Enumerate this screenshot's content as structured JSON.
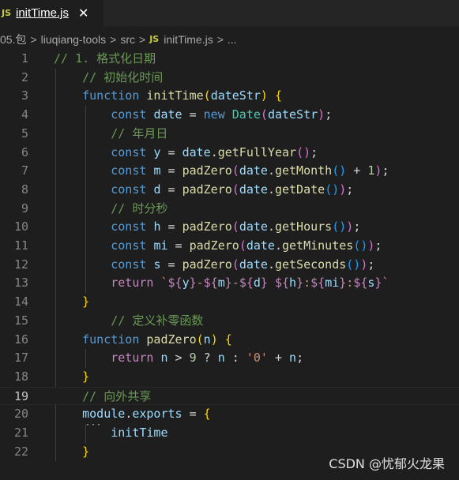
{
  "tab": {
    "icon_text": "JS",
    "label": "initTime.js",
    "close": "✕"
  },
  "breadcrumb": {
    "items": [
      "05.包",
      "liuqiang-tools",
      "src"
    ],
    "file_icon": "JS",
    "file": "initTime.js",
    "more": "..."
  },
  "watermark": "CSDN @忧郁火龙果",
  "code_lines": [
    {
      "n": "1",
      "tokens": [
        [
          "// 1. 格式化日期",
          "c"
        ]
      ]
    },
    {
      "n": "2",
      "tokens": [
        [
          "    // 初始化时间",
          "c"
        ]
      ]
    },
    {
      "n": "3",
      "tokens": [
        [
          "    ",
          "p"
        ],
        [
          "function",
          "k"
        ],
        [
          " ",
          "p"
        ],
        [
          "initTime",
          "f"
        ],
        [
          "(",
          "b1"
        ],
        [
          "dateStr",
          "v"
        ],
        [
          ")",
          "b1"
        ],
        [
          " ",
          "p"
        ],
        [
          "{",
          "b1"
        ]
      ]
    },
    {
      "n": "4",
      "tokens": [
        [
          "        ",
          "p"
        ],
        [
          "const",
          "k"
        ],
        [
          " ",
          "p"
        ],
        [
          "date",
          "v"
        ],
        [
          " = ",
          "p"
        ],
        [
          "new",
          "k"
        ],
        [
          " ",
          "p"
        ],
        [
          "Date",
          "t"
        ],
        [
          "(",
          "b2"
        ],
        [
          "dateStr",
          "v"
        ],
        [
          ")",
          "b2"
        ],
        [
          ";",
          "p"
        ]
      ]
    },
    {
      "n": "5",
      "tokens": [
        [
          "        // 年月日",
          "c"
        ]
      ]
    },
    {
      "n": "6",
      "tokens": [
        [
          "        ",
          "p"
        ],
        [
          "const",
          "k"
        ],
        [
          " ",
          "p"
        ],
        [
          "y",
          "v"
        ],
        [
          " = ",
          "p"
        ],
        [
          "date",
          "v"
        ],
        [
          ".",
          "p"
        ],
        [
          "getFullYear",
          "f"
        ],
        [
          "()",
          "b2"
        ],
        [
          ";",
          "p"
        ]
      ]
    },
    {
      "n": "7",
      "tokens": [
        [
          "        ",
          "p"
        ],
        [
          "const",
          "k"
        ],
        [
          " ",
          "p"
        ],
        [
          "m",
          "v"
        ],
        [
          " = ",
          "p"
        ],
        [
          "padZero",
          "f"
        ],
        [
          "(",
          "b2"
        ],
        [
          "date",
          "v"
        ],
        [
          ".",
          "p"
        ],
        [
          "getMonth",
          "f"
        ],
        [
          "()",
          "b3"
        ],
        [
          " + ",
          "p"
        ],
        [
          "1",
          "n"
        ],
        [
          ")",
          "b2"
        ],
        [
          ";",
          "p"
        ]
      ]
    },
    {
      "n": "8",
      "tokens": [
        [
          "        ",
          "p"
        ],
        [
          "const",
          "k"
        ],
        [
          " ",
          "p"
        ],
        [
          "d",
          "v"
        ],
        [
          " = ",
          "p"
        ],
        [
          "padZero",
          "f"
        ],
        [
          "(",
          "b2"
        ],
        [
          "date",
          "v"
        ],
        [
          ".",
          "p"
        ],
        [
          "getDate",
          "f"
        ],
        [
          "()",
          "b3"
        ],
        [
          ")",
          "b2"
        ],
        [
          ";",
          "p"
        ]
      ]
    },
    {
      "n": "9",
      "tokens": [
        [
          "        // 时分秒",
          "c"
        ]
      ]
    },
    {
      "n": "10",
      "tokens": [
        [
          "        ",
          "p"
        ],
        [
          "const",
          "k"
        ],
        [
          " ",
          "p"
        ],
        [
          "h",
          "v"
        ],
        [
          " = ",
          "p"
        ],
        [
          "padZero",
          "f"
        ],
        [
          "(",
          "b2"
        ],
        [
          "date",
          "v"
        ],
        [
          ".",
          "p"
        ],
        [
          "getHours",
          "f"
        ],
        [
          "()",
          "b3"
        ],
        [
          ")",
          "b2"
        ],
        [
          ";",
          "p"
        ]
      ]
    },
    {
      "n": "11",
      "tokens": [
        [
          "        ",
          "p"
        ],
        [
          "const",
          "k"
        ],
        [
          " ",
          "p"
        ],
        [
          "mi",
          "v"
        ],
        [
          " = ",
          "p"
        ],
        [
          "padZero",
          "f"
        ],
        [
          "(",
          "b2"
        ],
        [
          "date",
          "v"
        ],
        [
          ".",
          "p"
        ],
        [
          "getMinutes",
          "f"
        ],
        [
          "()",
          "b3"
        ],
        [
          ")",
          "b2"
        ],
        [
          ";",
          "p"
        ]
      ]
    },
    {
      "n": "12",
      "tokens": [
        [
          "        ",
          "p"
        ],
        [
          "const",
          "k"
        ],
        [
          " ",
          "p"
        ],
        [
          "s",
          "v"
        ],
        [
          " = ",
          "p"
        ],
        [
          "padZero",
          "f"
        ],
        [
          "(",
          "b2"
        ],
        [
          "date",
          "v"
        ],
        [
          ".",
          "p"
        ],
        [
          "getSeconds",
          "f"
        ],
        [
          "()",
          "b3"
        ],
        [
          ")",
          "b2"
        ],
        [
          ";",
          "p"
        ]
      ]
    },
    {
      "n": "13",
      "tokens": [
        [
          "        ",
          "p"
        ],
        [
          "return",
          "ctl"
        ],
        [
          " ",
          "p"
        ],
        [
          "`",
          "s"
        ],
        [
          "${",
          "ctl"
        ],
        [
          "y",
          "v"
        ],
        [
          "}",
          "ctl"
        ],
        [
          "-",
          "s"
        ],
        [
          "${",
          "ctl"
        ],
        [
          "m",
          "v"
        ],
        [
          "}",
          "ctl"
        ],
        [
          "-",
          "s"
        ],
        [
          "${",
          "ctl"
        ],
        [
          "d",
          "v"
        ],
        [
          "}",
          "ctl"
        ],
        [
          " ",
          "s"
        ],
        [
          "${",
          "ctl"
        ],
        [
          "h",
          "v"
        ],
        [
          "}",
          "ctl"
        ],
        [
          ":",
          "s"
        ],
        [
          "${",
          "ctl"
        ],
        [
          "mi",
          "v"
        ],
        [
          "}",
          "ctl"
        ],
        [
          ":",
          "s"
        ],
        [
          "${",
          "ctl"
        ],
        [
          "s",
          "v"
        ],
        [
          "}",
          "ctl"
        ],
        [
          "`",
          "s"
        ]
      ]
    },
    {
      "n": "14",
      "tokens": [
        [
          "    ",
          "p"
        ],
        [
          "}",
          "b1"
        ]
      ]
    },
    {
      "n": "15",
      "tokens": [
        [
          "        // 定义补零函数",
          "c"
        ]
      ]
    },
    {
      "n": "16",
      "tokens": [
        [
          "    ",
          "p"
        ],
        [
          "function",
          "k"
        ],
        [
          " ",
          "p"
        ],
        [
          "padZero",
          "f"
        ],
        [
          "(",
          "b1"
        ],
        [
          "n",
          "v"
        ],
        [
          ")",
          "b1"
        ],
        [
          " ",
          "p"
        ],
        [
          "{",
          "b1"
        ]
      ]
    },
    {
      "n": "17",
      "tokens": [
        [
          "        ",
          "p"
        ],
        [
          "return",
          "ctl"
        ],
        [
          " ",
          "p"
        ],
        [
          "n",
          "v"
        ],
        [
          " > ",
          "p"
        ],
        [
          "9",
          "n"
        ],
        [
          " ? ",
          "p"
        ],
        [
          "n",
          "v"
        ],
        [
          " : ",
          "p"
        ],
        [
          "'0'",
          "s"
        ],
        [
          " + ",
          "p"
        ],
        [
          "n",
          "v"
        ],
        [
          ";",
          "p"
        ]
      ]
    },
    {
      "n": "18",
      "tokens": [
        [
          "    ",
          "p"
        ],
        [
          "}",
          "b1"
        ]
      ]
    },
    {
      "n": "19",
      "tokens": [
        [
          "    // 向外共享",
          "c"
        ]
      ]
    },
    {
      "n": "20",
      "tokens": [
        [
          "    ",
          "p"
        ],
        [
          "module",
          "v"
        ],
        [
          ".",
          "p"
        ],
        [
          "exports",
          "v"
        ],
        [
          " = ",
          "p"
        ],
        [
          "{",
          "b1"
        ]
      ]
    },
    {
      "n": "21",
      "tokens": [
        [
          "        ",
          "p"
        ],
        [
          "initTime",
          "v"
        ]
      ]
    },
    {
      "n": "22",
      "tokens": [
        [
          "    ",
          "p"
        ],
        [
          "}",
          "b1"
        ]
      ]
    }
  ],
  "active_line": "19",
  "colors": {
    "background": "#1e1e1e",
    "comment": "#6a9955",
    "keyword": "#569cd6",
    "function": "#dcdcaa",
    "variable": "#9cdcfe",
    "class": "#4ec9b0",
    "number": "#b5cea8",
    "string": "#ce9178",
    "control": "#c586c0"
  }
}
